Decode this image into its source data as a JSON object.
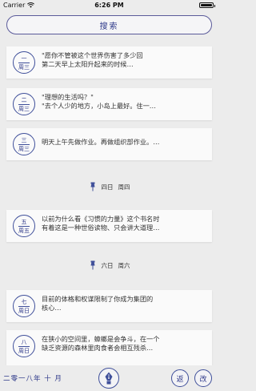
{
  "status_bar": {
    "carrier": "Carrier",
    "time": "6:26 PM",
    "battery_level": 1.0
  },
  "search": {
    "label": "搜索"
  },
  "entries": [
    {
      "day": "一",
      "week": "周三",
      "lines": [
        "\"愿你不管被这个世界伤害了多少回",
        "第二天早上太阳升起来的时候…"
      ]
    },
    {
      "day": "二",
      "week": "周三",
      "lines": [
        "\"理想的生活吗？\"",
        "\"去个人少的地方，小岛上最好。住一…"
      ]
    },
    {
      "day": "三",
      "week": "周三",
      "lines": [
        "明天上午先做作业。再做组织部作业。…"
      ]
    },
    {
      "day": "五",
      "week": "周五",
      "lines": [
        "以前为什么看《习惯的力量》这个书名时",
        "有着这是一种世俗读物、只会讲大道理…"
      ]
    },
    {
      "day": "七",
      "week": "周日",
      "lines": [
        "目前的体格和权谋限制了你成为集团的",
        "核心…"
      ]
    },
    {
      "day": "八",
      "week": "周日",
      "lines": [
        "在狭小的空间里，蟑螂是会争斗，在一个",
        "缺乏资源的森林里肉食者会相互残杀…"
      ]
    }
  ],
  "dividers": [
    {
      "day": "四日",
      "week": "周四"
    },
    {
      "day": "六日",
      "week": "周六"
    }
  ],
  "bottom_bar": {
    "month": "二零一八年 十 月",
    "left_button": "返",
    "right_button": "改"
  },
  "colors": {
    "accent": "#2f3a8a",
    "background": "#ececec",
    "card": "#fafafa"
  }
}
